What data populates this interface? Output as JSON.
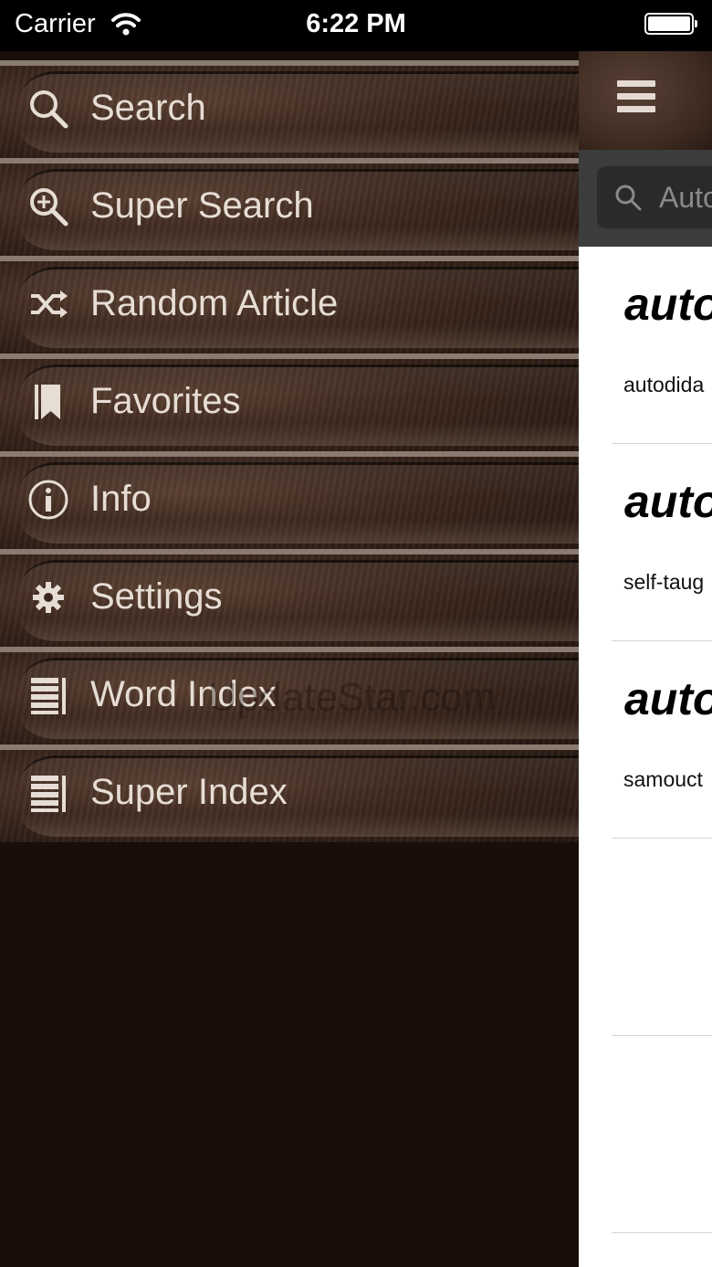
{
  "status_bar": {
    "carrier": "Carrier",
    "time": "6:22 PM"
  },
  "menu": {
    "items": [
      {
        "label": "Search",
        "icon": "search-icon"
      },
      {
        "label": "Super Search",
        "icon": "zoom-in-icon"
      },
      {
        "label": "Random Article",
        "icon": "shuffle-icon"
      },
      {
        "label": "Favorites",
        "icon": "bookmark-icon"
      },
      {
        "label": "Info",
        "icon": "info-icon"
      },
      {
        "label": "Settings",
        "icon": "gear-icon"
      },
      {
        "label": "Word Index",
        "icon": "list-icon"
      },
      {
        "label": "Super Index",
        "icon": "list-icon"
      }
    ]
  },
  "watermark": "UpdateStar.com",
  "main": {
    "search": {
      "value": "Auto"
    },
    "results": [
      {
        "word": "auto",
        "definition": "autodida"
      },
      {
        "word": "auto",
        "definition": "self-taug"
      },
      {
        "word": "auto",
        "definition": "samouct"
      },
      {
        "word": "",
        "definition": ""
      },
      {
        "word": "",
        "definition": ""
      }
    ]
  },
  "colors": {
    "menu_text": "#e6ddd4",
    "menu_background": "#1a0e0b",
    "results_background": "#ffffff"
  }
}
